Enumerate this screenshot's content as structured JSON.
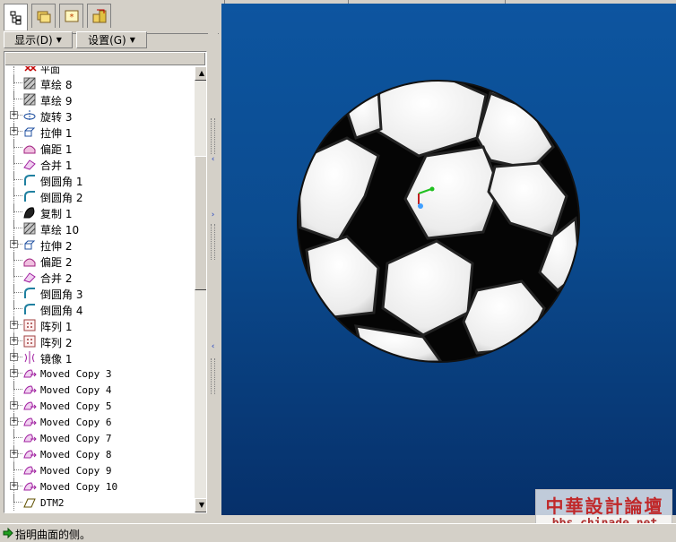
{
  "tabs": [
    {
      "name": "model-tree-tab",
      "active": true
    },
    {
      "name": "folder-browser-tab",
      "active": false
    },
    {
      "name": "favorites-tab",
      "active": false
    },
    {
      "name": "connections-tab",
      "active": false
    }
  ],
  "menus": {
    "display_label": "显示(D)",
    "settings_label": "设置(G)"
  },
  "tree": {
    "partial_top_label": "平面",
    "items": [
      {
        "label": "草绘 8",
        "icon": "sketch",
        "expand": false,
        "mono": false
      },
      {
        "label": "草绘 9",
        "icon": "sketch",
        "expand": false,
        "mono": false
      },
      {
        "label": "旋转 3",
        "icon": "revolve",
        "expand": true,
        "mono": false
      },
      {
        "label": "拉伸 1",
        "icon": "extrude",
        "expand": true,
        "mono": false
      },
      {
        "label": "偏距 1",
        "icon": "offset",
        "expand": false,
        "mono": false
      },
      {
        "label": "合并 1",
        "icon": "merge",
        "expand": false,
        "mono": false
      },
      {
        "label": "倒圆角 1",
        "icon": "round",
        "expand": false,
        "mono": false
      },
      {
        "label": "倒圆角 2",
        "icon": "round",
        "expand": false,
        "mono": false
      },
      {
        "label": "复制 1",
        "icon": "copy",
        "expand": false,
        "mono": false
      },
      {
        "label": "草绘 10",
        "icon": "sketch",
        "expand": false,
        "mono": false
      },
      {
        "label": "拉伸 2",
        "icon": "extrude",
        "expand": true,
        "mono": false
      },
      {
        "label": "偏距 2",
        "icon": "offset",
        "expand": false,
        "mono": false
      },
      {
        "label": "合并 2",
        "icon": "merge",
        "expand": false,
        "mono": false
      },
      {
        "label": "倒圆角 3",
        "icon": "round",
        "expand": false,
        "mono": false
      },
      {
        "label": "倒圆角 4",
        "icon": "round",
        "expand": false,
        "mono": false
      },
      {
        "label": "阵列 1",
        "icon": "pattern",
        "expand": true,
        "mono": false
      },
      {
        "label": "阵列 2",
        "icon": "pattern",
        "expand": true,
        "mono": false
      },
      {
        "label": "镜像 1",
        "icon": "mirror",
        "expand": true,
        "mono": false
      },
      {
        "label": "Moved Copy 3",
        "icon": "moved-copy",
        "expand": true,
        "mono": true
      },
      {
        "label": "Moved Copy 4",
        "icon": "moved-copy",
        "expand": false,
        "mono": true
      },
      {
        "label": "Moved Copy 5",
        "icon": "moved-copy",
        "expand": true,
        "mono": true
      },
      {
        "label": "Moved Copy 6",
        "icon": "moved-copy",
        "expand": true,
        "mono": true
      },
      {
        "label": "Moved Copy 7",
        "icon": "moved-copy",
        "expand": false,
        "mono": true
      },
      {
        "label": "Moved Copy 8",
        "icon": "moved-copy",
        "expand": true,
        "mono": true
      },
      {
        "label": "Moved Copy 9",
        "icon": "moved-copy",
        "expand": false,
        "mono": true
      },
      {
        "label": "Moved Copy 10",
        "icon": "moved-copy",
        "expand": true,
        "mono": true
      },
      {
        "label": "DTM2",
        "icon": "datum-plane",
        "expand": false,
        "mono": true
      }
    ]
  },
  "watermark": {
    "cn": "中華設計論壇",
    "url": "bbs.chinade.net"
  },
  "status": {
    "text": "指明曲面的侧。",
    "icon": "green-arrow-icon"
  },
  "colors": {
    "viewport_top": "#0d55a0",
    "viewport_bottom": "#06306a",
    "ball_white": "#f2f2f2",
    "ball_black": "#050505",
    "watermark_red": "#c0282a"
  }
}
